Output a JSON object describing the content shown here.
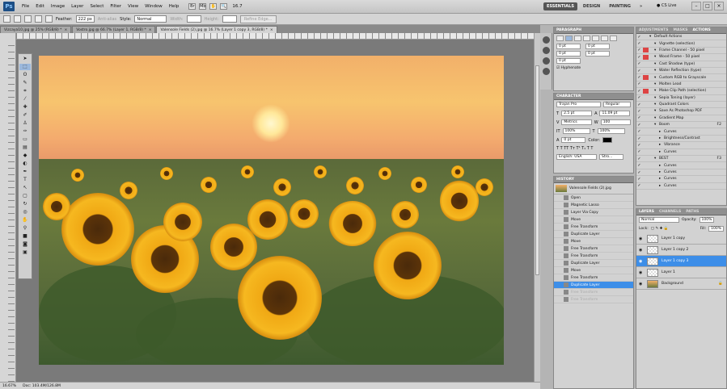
{
  "menubar": {
    "app_icon": "Ps",
    "items": [
      "File",
      "Edit",
      "Image",
      "Layer",
      "Select",
      "Filter",
      "View",
      "Window",
      "Help"
    ],
    "zoom_value": "16.7",
    "workspaces": [
      "ESSENTIALS",
      "DESIGN",
      "PAINTING",
      "»"
    ],
    "cs_live": "CS Live"
  },
  "options": {
    "feather_label": "Feather:",
    "feather_value": "222 px",
    "antialias_label": "Anti-alias",
    "style_label": "Style:",
    "style_value": "Normal",
    "width_label": "Width:",
    "height_label": "Height:",
    "refine_label": "Refine Edge..."
  },
  "tabs": [
    {
      "label": "Vizcaya10.jpg @ 25% (RGB/8) *"
    },
    {
      "label": "Vostro.jpg @ 66.7% (Layer 1, RGB/8) *"
    },
    {
      "label": "Valensole Fields (2).jpg @ 16.7% (Layer 1 copy 3, RGB/8) *"
    }
  ],
  "status": {
    "zoom": "16.67%",
    "doc": "Doc: 103.4M/126.8M"
  },
  "paragraph_panel": {
    "title": "PARAGRAPH",
    "fields": [
      "0 pt",
      "0 pt",
      "0 pt",
      "0 pt",
      "0 pt"
    ],
    "hyphenate": "Hyphenate"
  },
  "character_panel": {
    "title": "CHARACTER",
    "font": "Trajan Pro",
    "style": "Regular",
    "size": "2.5 pt",
    "leading": "11.09 pt",
    "kerning": "Metrics",
    "tracking": "100",
    "vscale": "100%",
    "hscale": "100%",
    "baseline": "0 pt",
    "color_label": "Color:",
    "language": "English: USA",
    "aa": "Stro..."
  },
  "history_panel": {
    "title": "HISTORY",
    "snapshot": "Valensole Fields (2).jpg",
    "items": [
      {
        "label": "Open",
        "state": "normal"
      },
      {
        "label": "Magnetic Lasso",
        "state": "normal"
      },
      {
        "label": "Layer Via Copy",
        "state": "normal"
      },
      {
        "label": "Move",
        "state": "normal"
      },
      {
        "label": "Free Transform",
        "state": "normal"
      },
      {
        "label": "Duplicate Layer",
        "state": "normal"
      },
      {
        "label": "Move",
        "state": "normal"
      },
      {
        "label": "Free Transform",
        "state": "normal"
      },
      {
        "label": "Free Transform",
        "state": "normal"
      },
      {
        "label": "Duplicate Layer",
        "state": "normal"
      },
      {
        "label": "Move",
        "state": "normal"
      },
      {
        "label": "Free Transform",
        "state": "normal"
      },
      {
        "label": "Duplicate Layer",
        "state": "selected"
      },
      {
        "label": "Free Transform",
        "state": "dim"
      },
      {
        "label": "Free Transform",
        "state": "dim"
      }
    ]
  },
  "actions_panel": {
    "tabs": [
      "ADJUSTMENTS",
      "MASKS",
      "ACTIONS"
    ],
    "rows": [
      {
        "label": "Default Actions",
        "indent": 0,
        "mod": "",
        "key": ""
      },
      {
        "label": "Vignette (selection)",
        "indent": 1,
        "mod": "",
        "key": ""
      },
      {
        "label": "Frame Channel - 50 pixel",
        "indent": 1,
        "mod": "red",
        "key": ""
      },
      {
        "label": "Wood Frame - 50 pixel",
        "indent": 1,
        "mod": "red",
        "key": ""
      },
      {
        "label": "Cast Shadow (type)",
        "indent": 1,
        "mod": "",
        "key": ""
      },
      {
        "label": "Water Reflection (type)",
        "indent": 1,
        "mod": "",
        "key": ""
      },
      {
        "label": "Custom RGB to Grayscale",
        "indent": 1,
        "mod": "red",
        "key": ""
      },
      {
        "label": "Molten Lead",
        "indent": 1,
        "mod": "",
        "key": ""
      },
      {
        "label": "Make Clip Path (selection)",
        "indent": 1,
        "mod": "red",
        "key": ""
      },
      {
        "label": "Sepia Toning (layer)",
        "indent": 1,
        "mod": "",
        "key": ""
      },
      {
        "label": "Quadrant Colors",
        "indent": 1,
        "mod": "",
        "key": ""
      },
      {
        "label": "Save As Photoshop PDF",
        "indent": 1,
        "mod": "",
        "key": ""
      },
      {
        "label": "Gradient Map",
        "indent": 1,
        "mod": "",
        "key": ""
      },
      {
        "label": "Boom",
        "indent": 1,
        "mod": "",
        "key": "F2"
      },
      {
        "label": "Curves",
        "indent": 2,
        "mod": "",
        "key": ""
      },
      {
        "label": "Brightness/Contrast",
        "indent": 2,
        "mod": "",
        "key": ""
      },
      {
        "label": "Vibrance",
        "indent": 2,
        "mod": "",
        "key": ""
      },
      {
        "label": "Curves",
        "indent": 2,
        "mod": "",
        "key": ""
      },
      {
        "label": "BEST",
        "indent": 1,
        "mod": "",
        "key": "F3"
      },
      {
        "label": "Curves",
        "indent": 2,
        "mod": "",
        "key": ""
      },
      {
        "label": "Curves",
        "indent": 2,
        "mod": "",
        "key": ""
      },
      {
        "label": "Curves",
        "indent": 2,
        "mod": "",
        "key": ""
      },
      {
        "label": "Curves",
        "indent": 2,
        "mod": "",
        "key": ""
      }
    ]
  },
  "layers_panel": {
    "tabs": [
      "LAYERS",
      "CHANNELS",
      "PATHS"
    ],
    "blend": "Normal",
    "opacity_label": "Opacity:",
    "opacity": "100%",
    "lock_label": "Lock:",
    "fill_label": "Fill:",
    "fill": "100%",
    "layers": [
      {
        "label": "Layer 1 copy",
        "selected": false,
        "bg": false
      },
      {
        "label": "Layer 1 copy 2",
        "selected": false,
        "bg": false
      },
      {
        "label": "Layer 1 copy 3",
        "selected": true,
        "bg": false
      },
      {
        "label": "Layer 1",
        "selected": false,
        "bg": false
      },
      {
        "label": "Background",
        "selected": false,
        "bg": true
      }
    ]
  },
  "colors": {
    "accent": "#3d8ee8",
    "panel_bg": "#d2d2d2"
  }
}
